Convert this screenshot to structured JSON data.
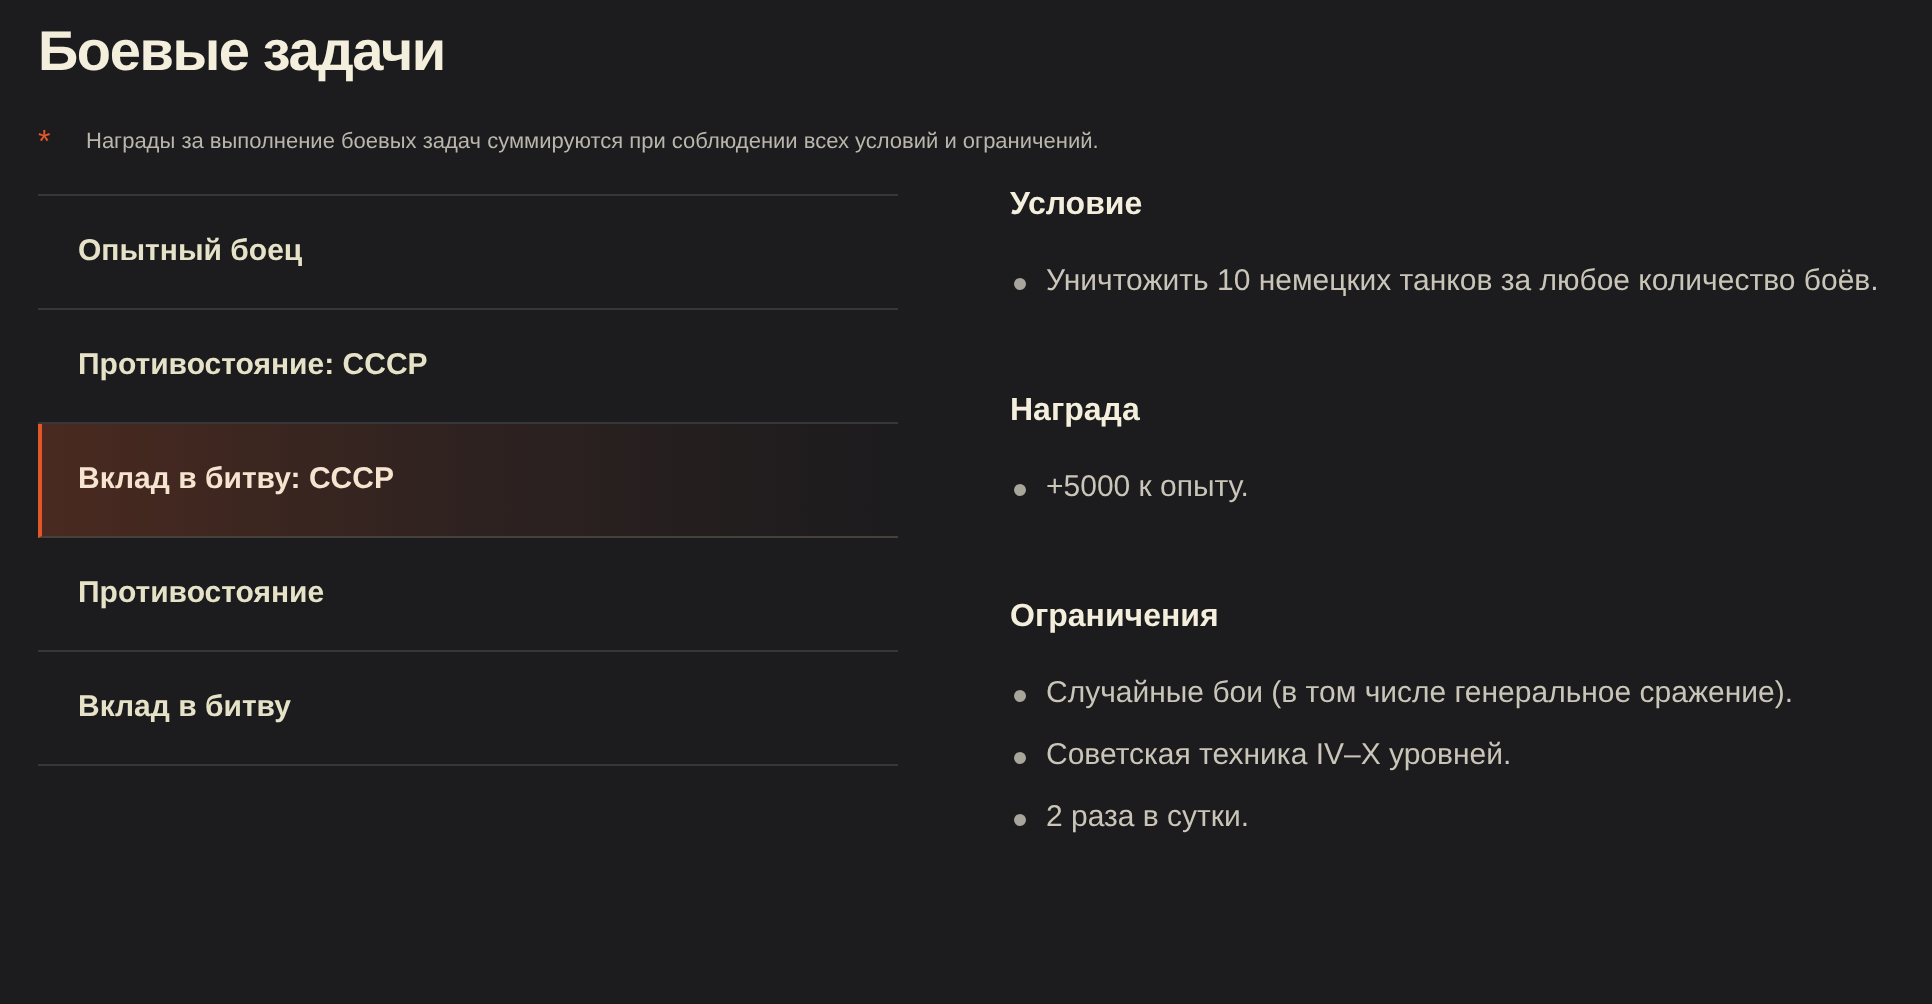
{
  "title": "Боевые задачи",
  "note": {
    "mark": "*",
    "text": "Награды за выполнение боевых задач суммируются при соблюдении всех условий и ограничений."
  },
  "missions": [
    {
      "label": "Опытный боец",
      "selected": false
    },
    {
      "label": "Противостояние: СССР",
      "selected": false
    },
    {
      "label": "Вклад в битву: СССР",
      "selected": true
    },
    {
      "label": "Противостояние",
      "selected": false
    },
    {
      "label": "Вклад в битву",
      "selected": false
    }
  ],
  "sections": [
    {
      "heading": "Условие",
      "items": [
        "Уничтожить 10 немецких танков за любое количество боёв."
      ]
    },
    {
      "heading": "Награда",
      "items": [
        "+5000 к опыту."
      ]
    },
    {
      "heading": "Ограничения",
      "items": [
        "Случайные бои (в том числе генеральное сражение).",
        "Советская техника IV–X уровней.",
        "2 раза в сутки."
      ]
    }
  ]
}
